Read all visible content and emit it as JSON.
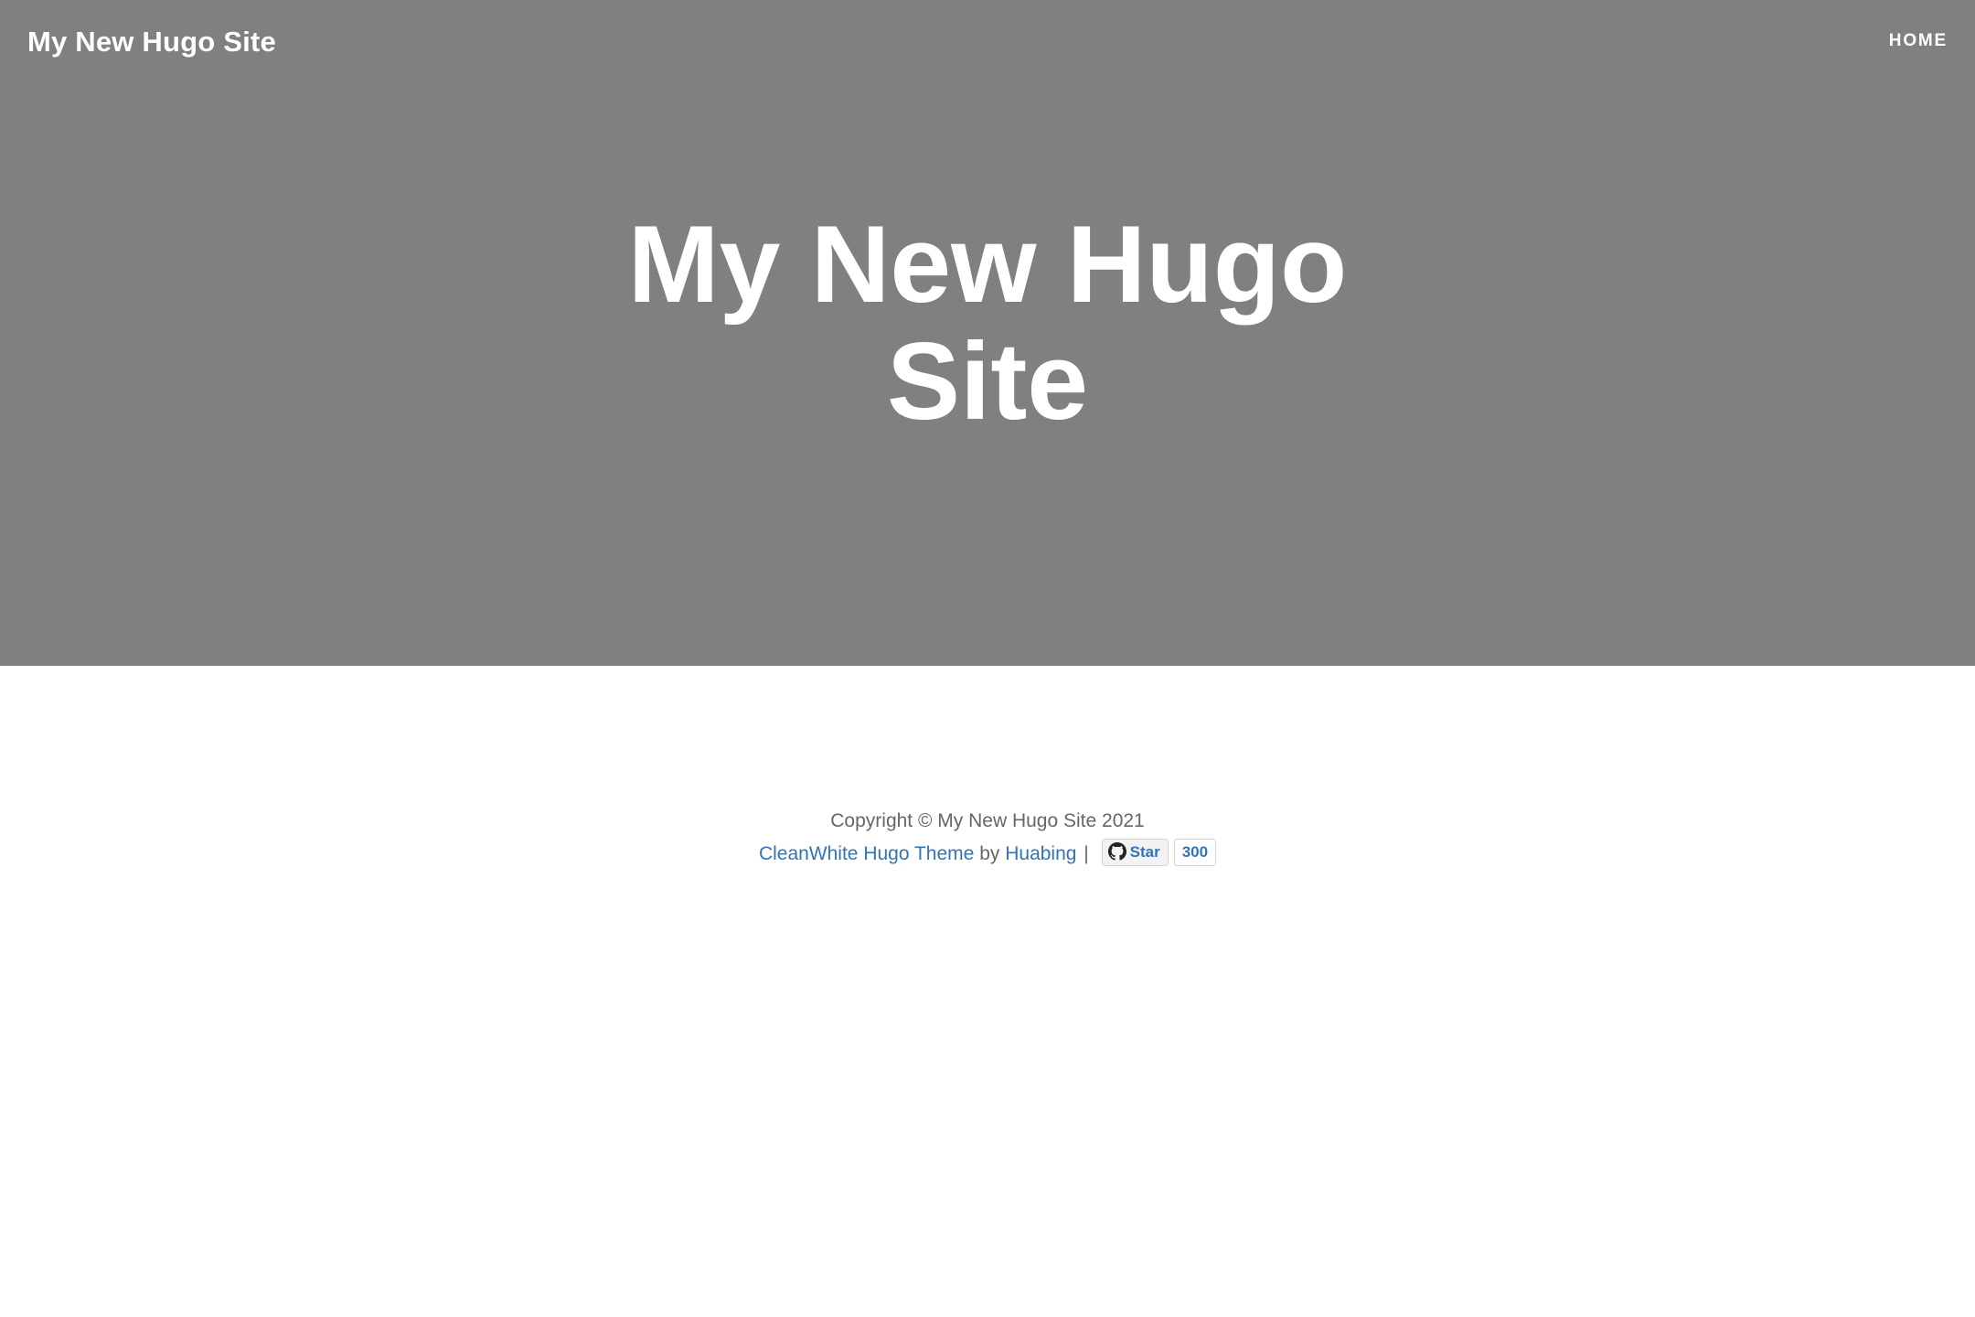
{
  "navbar": {
    "brand": "My New Hugo Site",
    "links": [
      {
        "label": "HOME"
      }
    ]
  },
  "hero": {
    "title_line1": "My New Hugo",
    "title_line2": "Site",
    "background_color": "#808080"
  },
  "footer": {
    "copyright": "Copyright © My New Hugo Site 2021",
    "theme_link": "CleanWhite Hugo Theme",
    "by_text": "by",
    "author_link": "Huabing",
    "separator": "|",
    "github_star_label": "Star",
    "github_star_count": "300",
    "link_color": "#3473b5",
    "icons": [
      "github-icon"
    ]
  }
}
